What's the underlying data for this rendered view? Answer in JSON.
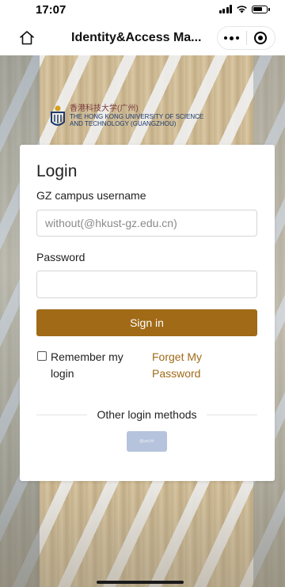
{
  "status_bar": {
    "time": "17:07"
  },
  "nav_bar": {
    "title": "Identity&Access Ma..."
  },
  "logo": {
    "cn_text": "香港科技大学(广州)",
    "en_line1": "THE HONG KONG UNIVERSITY OF SCIENCE",
    "en_line2": "AND TECHNOLOGY (GUANGZHOU)"
  },
  "login": {
    "title": "Login",
    "username_label": "GZ campus username",
    "username_placeholder": "without(@hkust-gz.edu.cn)",
    "username_value": "",
    "password_label": "Password",
    "password_value": "",
    "signin_label": "Sign in",
    "remember_label": "Remember my login",
    "remember_checked": false,
    "forget_label": "Forget My Password",
    "other_methods_label": "Other login methods",
    "ust_button_label": "@ust.hk"
  },
  "colors": {
    "accent": "#a06a17",
    "ust_button": "#b6c3dc"
  },
  "icons": {
    "nav_left": "home-icon",
    "capsule_more": "more-icon",
    "capsule_close": "target-icon"
  }
}
